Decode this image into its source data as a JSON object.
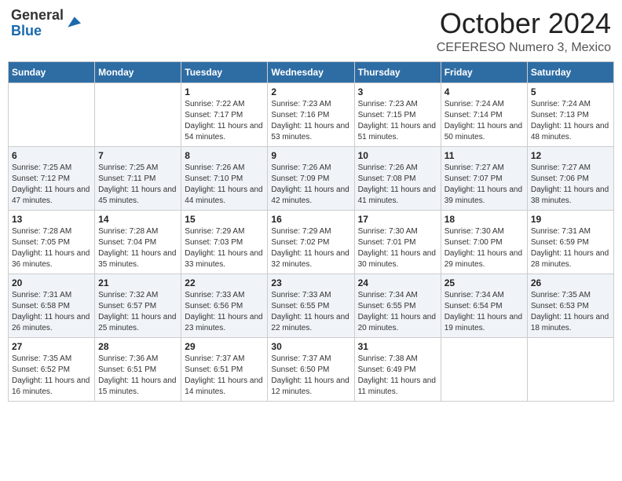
{
  "logo": {
    "general": "General",
    "blue": "Blue"
  },
  "header": {
    "month": "October 2024",
    "location": "CEFERESO Numero 3, Mexico"
  },
  "weekdays": [
    "Sunday",
    "Monday",
    "Tuesday",
    "Wednesday",
    "Thursday",
    "Friday",
    "Saturday"
  ],
  "weeks": [
    [
      {
        "day": "",
        "sunrise": "",
        "sunset": "",
        "daylight": ""
      },
      {
        "day": "",
        "sunrise": "",
        "sunset": "",
        "daylight": ""
      },
      {
        "day": "1",
        "sunrise": "Sunrise: 7:22 AM",
        "sunset": "Sunset: 7:17 PM",
        "daylight": "Daylight: 11 hours and 54 minutes."
      },
      {
        "day": "2",
        "sunrise": "Sunrise: 7:23 AM",
        "sunset": "Sunset: 7:16 PM",
        "daylight": "Daylight: 11 hours and 53 minutes."
      },
      {
        "day": "3",
        "sunrise": "Sunrise: 7:23 AM",
        "sunset": "Sunset: 7:15 PM",
        "daylight": "Daylight: 11 hours and 51 minutes."
      },
      {
        "day": "4",
        "sunrise": "Sunrise: 7:24 AM",
        "sunset": "Sunset: 7:14 PM",
        "daylight": "Daylight: 11 hours and 50 minutes."
      },
      {
        "day": "5",
        "sunrise": "Sunrise: 7:24 AM",
        "sunset": "Sunset: 7:13 PM",
        "daylight": "Daylight: 11 hours and 48 minutes."
      }
    ],
    [
      {
        "day": "6",
        "sunrise": "Sunrise: 7:25 AM",
        "sunset": "Sunset: 7:12 PM",
        "daylight": "Daylight: 11 hours and 47 minutes."
      },
      {
        "day": "7",
        "sunrise": "Sunrise: 7:25 AM",
        "sunset": "Sunset: 7:11 PM",
        "daylight": "Daylight: 11 hours and 45 minutes."
      },
      {
        "day": "8",
        "sunrise": "Sunrise: 7:26 AM",
        "sunset": "Sunset: 7:10 PM",
        "daylight": "Daylight: 11 hours and 44 minutes."
      },
      {
        "day": "9",
        "sunrise": "Sunrise: 7:26 AM",
        "sunset": "Sunset: 7:09 PM",
        "daylight": "Daylight: 11 hours and 42 minutes."
      },
      {
        "day": "10",
        "sunrise": "Sunrise: 7:26 AM",
        "sunset": "Sunset: 7:08 PM",
        "daylight": "Daylight: 11 hours and 41 minutes."
      },
      {
        "day": "11",
        "sunrise": "Sunrise: 7:27 AM",
        "sunset": "Sunset: 7:07 PM",
        "daylight": "Daylight: 11 hours and 39 minutes."
      },
      {
        "day": "12",
        "sunrise": "Sunrise: 7:27 AM",
        "sunset": "Sunset: 7:06 PM",
        "daylight": "Daylight: 11 hours and 38 minutes."
      }
    ],
    [
      {
        "day": "13",
        "sunrise": "Sunrise: 7:28 AM",
        "sunset": "Sunset: 7:05 PM",
        "daylight": "Daylight: 11 hours and 36 minutes."
      },
      {
        "day": "14",
        "sunrise": "Sunrise: 7:28 AM",
        "sunset": "Sunset: 7:04 PM",
        "daylight": "Daylight: 11 hours and 35 minutes."
      },
      {
        "day": "15",
        "sunrise": "Sunrise: 7:29 AM",
        "sunset": "Sunset: 7:03 PM",
        "daylight": "Daylight: 11 hours and 33 minutes."
      },
      {
        "day": "16",
        "sunrise": "Sunrise: 7:29 AM",
        "sunset": "Sunset: 7:02 PM",
        "daylight": "Daylight: 11 hours and 32 minutes."
      },
      {
        "day": "17",
        "sunrise": "Sunrise: 7:30 AM",
        "sunset": "Sunset: 7:01 PM",
        "daylight": "Daylight: 11 hours and 30 minutes."
      },
      {
        "day": "18",
        "sunrise": "Sunrise: 7:30 AM",
        "sunset": "Sunset: 7:00 PM",
        "daylight": "Daylight: 11 hours and 29 minutes."
      },
      {
        "day": "19",
        "sunrise": "Sunrise: 7:31 AM",
        "sunset": "Sunset: 6:59 PM",
        "daylight": "Daylight: 11 hours and 28 minutes."
      }
    ],
    [
      {
        "day": "20",
        "sunrise": "Sunrise: 7:31 AM",
        "sunset": "Sunset: 6:58 PM",
        "daylight": "Daylight: 11 hours and 26 minutes."
      },
      {
        "day": "21",
        "sunrise": "Sunrise: 7:32 AM",
        "sunset": "Sunset: 6:57 PM",
        "daylight": "Daylight: 11 hours and 25 minutes."
      },
      {
        "day": "22",
        "sunrise": "Sunrise: 7:33 AM",
        "sunset": "Sunset: 6:56 PM",
        "daylight": "Daylight: 11 hours and 23 minutes."
      },
      {
        "day": "23",
        "sunrise": "Sunrise: 7:33 AM",
        "sunset": "Sunset: 6:55 PM",
        "daylight": "Daylight: 11 hours and 22 minutes."
      },
      {
        "day": "24",
        "sunrise": "Sunrise: 7:34 AM",
        "sunset": "Sunset: 6:55 PM",
        "daylight": "Daylight: 11 hours and 20 minutes."
      },
      {
        "day": "25",
        "sunrise": "Sunrise: 7:34 AM",
        "sunset": "Sunset: 6:54 PM",
        "daylight": "Daylight: 11 hours and 19 minutes."
      },
      {
        "day": "26",
        "sunrise": "Sunrise: 7:35 AM",
        "sunset": "Sunset: 6:53 PM",
        "daylight": "Daylight: 11 hours and 18 minutes."
      }
    ],
    [
      {
        "day": "27",
        "sunrise": "Sunrise: 7:35 AM",
        "sunset": "Sunset: 6:52 PM",
        "daylight": "Daylight: 11 hours and 16 minutes."
      },
      {
        "day": "28",
        "sunrise": "Sunrise: 7:36 AM",
        "sunset": "Sunset: 6:51 PM",
        "daylight": "Daylight: 11 hours and 15 minutes."
      },
      {
        "day": "29",
        "sunrise": "Sunrise: 7:37 AM",
        "sunset": "Sunset: 6:51 PM",
        "daylight": "Daylight: 11 hours and 14 minutes."
      },
      {
        "day": "30",
        "sunrise": "Sunrise: 7:37 AM",
        "sunset": "Sunset: 6:50 PM",
        "daylight": "Daylight: 11 hours and 12 minutes."
      },
      {
        "day": "31",
        "sunrise": "Sunrise: 7:38 AM",
        "sunset": "Sunset: 6:49 PM",
        "daylight": "Daylight: 11 hours and 11 minutes."
      },
      {
        "day": "",
        "sunrise": "",
        "sunset": "",
        "daylight": ""
      },
      {
        "day": "",
        "sunrise": "",
        "sunset": "",
        "daylight": ""
      }
    ]
  ]
}
